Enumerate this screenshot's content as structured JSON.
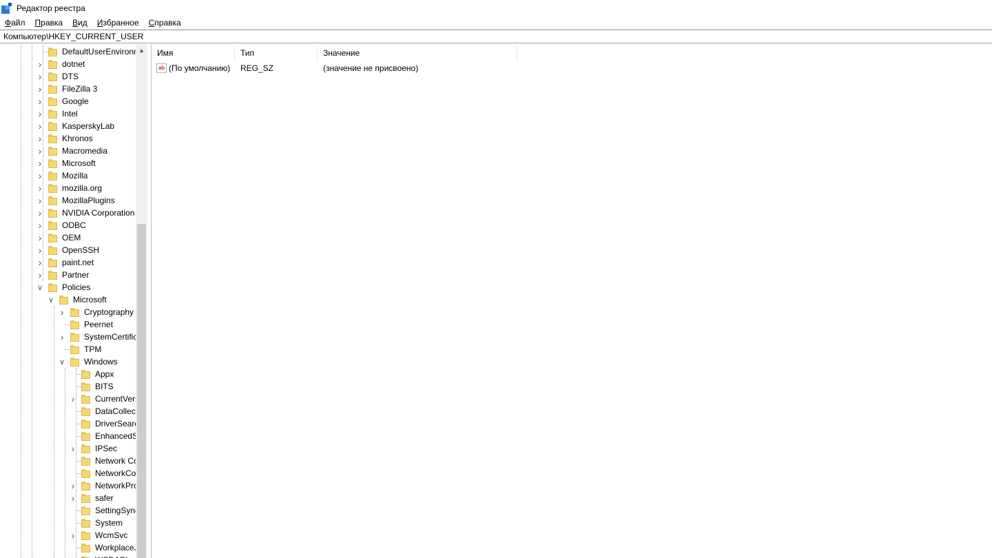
{
  "window": {
    "title": "Редактор реестра"
  },
  "menu": [
    {
      "label": "Файл",
      "accel": "Ф",
      "rest": "айл"
    },
    {
      "label": "Правка",
      "accel": "П",
      "rest": "равка"
    },
    {
      "label": "Вид",
      "accel": "В",
      "rest": "ид"
    },
    {
      "label": "Избранное",
      "accel": "И",
      "rest": "збранное"
    },
    {
      "label": "Справка",
      "accel": "С",
      "rest": "правка"
    }
  ],
  "address": "Компьютер\\HKEY_CURRENT_USER",
  "tree": [
    {
      "label": "DefaultUserEnvironn",
      "level": 1,
      "expander": "none"
    },
    {
      "label": "dotnet",
      "level": 1,
      "expander": "collapsed"
    },
    {
      "label": "DTS",
      "level": 1,
      "expander": "collapsed"
    },
    {
      "label": "FileZilla 3",
      "level": 1,
      "expander": "collapsed"
    },
    {
      "label": "Google",
      "level": 1,
      "expander": "collapsed"
    },
    {
      "label": "Intel",
      "level": 1,
      "expander": "collapsed"
    },
    {
      "label": "KasperskyLab",
      "level": 1,
      "expander": "collapsed"
    },
    {
      "label": "Khronos",
      "level": 1,
      "expander": "collapsed"
    },
    {
      "label": "Macromedia",
      "level": 1,
      "expander": "collapsed"
    },
    {
      "label": "Microsoft",
      "level": 1,
      "expander": "collapsed"
    },
    {
      "label": "Mozilla",
      "level": 1,
      "expander": "collapsed"
    },
    {
      "label": "mozilla.org",
      "level": 1,
      "expander": "collapsed"
    },
    {
      "label": "MozillaPlugins",
      "level": 1,
      "expander": "collapsed"
    },
    {
      "label": "NVIDIA Corporation",
      "level": 1,
      "expander": "collapsed"
    },
    {
      "label": "ODBC",
      "level": 1,
      "expander": "collapsed"
    },
    {
      "label": "OEM",
      "level": 1,
      "expander": "collapsed"
    },
    {
      "label": "OpenSSH",
      "level": 1,
      "expander": "collapsed"
    },
    {
      "label": "paint.net",
      "level": 1,
      "expander": "collapsed"
    },
    {
      "label": "Partner",
      "level": 1,
      "expander": "collapsed"
    },
    {
      "label": "Policies",
      "level": 1,
      "expander": "expanded"
    },
    {
      "label": "Microsoft",
      "level": 2,
      "expander": "expanded"
    },
    {
      "label": "Cryptography",
      "level": 3,
      "expander": "collapsed"
    },
    {
      "label": "Peernet",
      "level": 3,
      "expander": "none"
    },
    {
      "label": "SystemCertific",
      "level": 3,
      "expander": "collapsed"
    },
    {
      "label": "TPM",
      "level": 3,
      "expander": "none"
    },
    {
      "label": "Windows",
      "level": 3,
      "expander": "expanded"
    },
    {
      "label": "Appx",
      "level": 4,
      "expander": "none"
    },
    {
      "label": "BITS",
      "level": 4,
      "expander": "none"
    },
    {
      "label": "CurrentVers",
      "level": 4,
      "expander": "collapsed"
    },
    {
      "label": "DataCollect",
      "level": 4,
      "expander": "none"
    },
    {
      "label": "DriverSearc",
      "level": 4,
      "expander": "none"
    },
    {
      "label": "EnhancedS",
      "level": 4,
      "expander": "none"
    },
    {
      "label": "IPSec",
      "level": 4,
      "expander": "collapsed"
    },
    {
      "label": "Network Co",
      "level": 4,
      "expander": "none"
    },
    {
      "label": "NetworkCo",
      "level": 4,
      "expander": "none"
    },
    {
      "label": "NetworkPro",
      "level": 4,
      "expander": "collapsed"
    },
    {
      "label": "safer",
      "level": 4,
      "expander": "collapsed"
    },
    {
      "label": "SettingSync",
      "level": 4,
      "expander": "none"
    },
    {
      "label": "System",
      "level": 4,
      "expander": "none"
    },
    {
      "label": "WcmSvc",
      "level": 4,
      "expander": "collapsed"
    },
    {
      "label": "WorkplaceJ",
      "level": 4,
      "expander": "none"
    },
    {
      "label": "WSDAPI",
      "level": 4,
      "expander": "none"
    }
  ],
  "columns": [
    {
      "label": "Имя"
    },
    {
      "label": "Тип"
    },
    {
      "label": "Значение"
    }
  ],
  "values": [
    {
      "name": "(По умолчанию)",
      "type": "REG_SZ",
      "data": "(значение не присвоено)",
      "icon": "string-value-icon"
    }
  ],
  "colors": {
    "folder": "#f7d774",
    "app_icon": "#2b7cd3",
    "ab_icon": "#c0392b"
  }
}
